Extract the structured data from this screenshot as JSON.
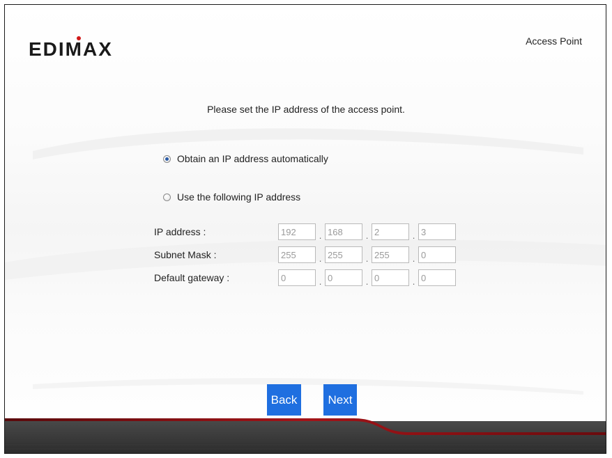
{
  "header": {
    "logo_text": "EDIMAX",
    "mode_title": "Access Point"
  },
  "main": {
    "prompt": "Please set the IP address of the access point.",
    "options": {
      "auto": {
        "label": "Obtain an IP address automatically",
        "selected": true
      },
      "manual": {
        "label": "Use the following IP address",
        "selected": false
      }
    },
    "fields": [
      {
        "label": "IP address :",
        "octets": [
          "192",
          "168",
          "2",
          "3"
        ]
      },
      {
        "label": "Subnet Mask :",
        "octets": [
          "255",
          "255",
          "255",
          "0"
        ]
      },
      {
        "label": "Default gateway :",
        "octets": [
          "0",
          "0",
          "0",
          "0"
        ]
      }
    ]
  },
  "buttons": {
    "back": "Back",
    "next": "Next"
  },
  "colors": {
    "button": "#1f6fe0",
    "footer_dark": "#3b3b3b",
    "accent_red": "#8c0f12"
  }
}
